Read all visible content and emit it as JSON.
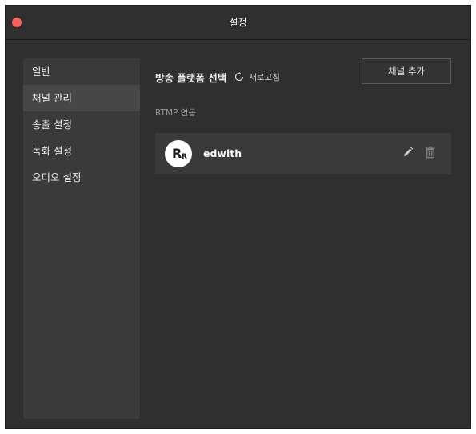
{
  "window": {
    "title": "설정"
  },
  "colors": {
    "close": "#fe5f57",
    "background": "#2f2f2f",
    "sidebar": "#3a3a3a",
    "active": "#474747"
  },
  "sidebar": {
    "items": [
      {
        "label": "일반",
        "active": false
      },
      {
        "label": "채널 관리",
        "active": true
      },
      {
        "label": "송출 설정",
        "active": false
      },
      {
        "label": "녹화 설정",
        "active": false
      },
      {
        "label": "오디오 설정",
        "active": false
      }
    ]
  },
  "main": {
    "platform_title": "방송 플랫폼 선택",
    "refresh_label": "새로고침",
    "add_channel_label": "채널 추가",
    "section_label": "RTMP 연동",
    "channel": {
      "avatar_big": "R",
      "avatar_small": "R",
      "name": "edwith",
      "edit_icon": "pencil-icon",
      "delete_icon": "trash-icon"
    }
  }
}
